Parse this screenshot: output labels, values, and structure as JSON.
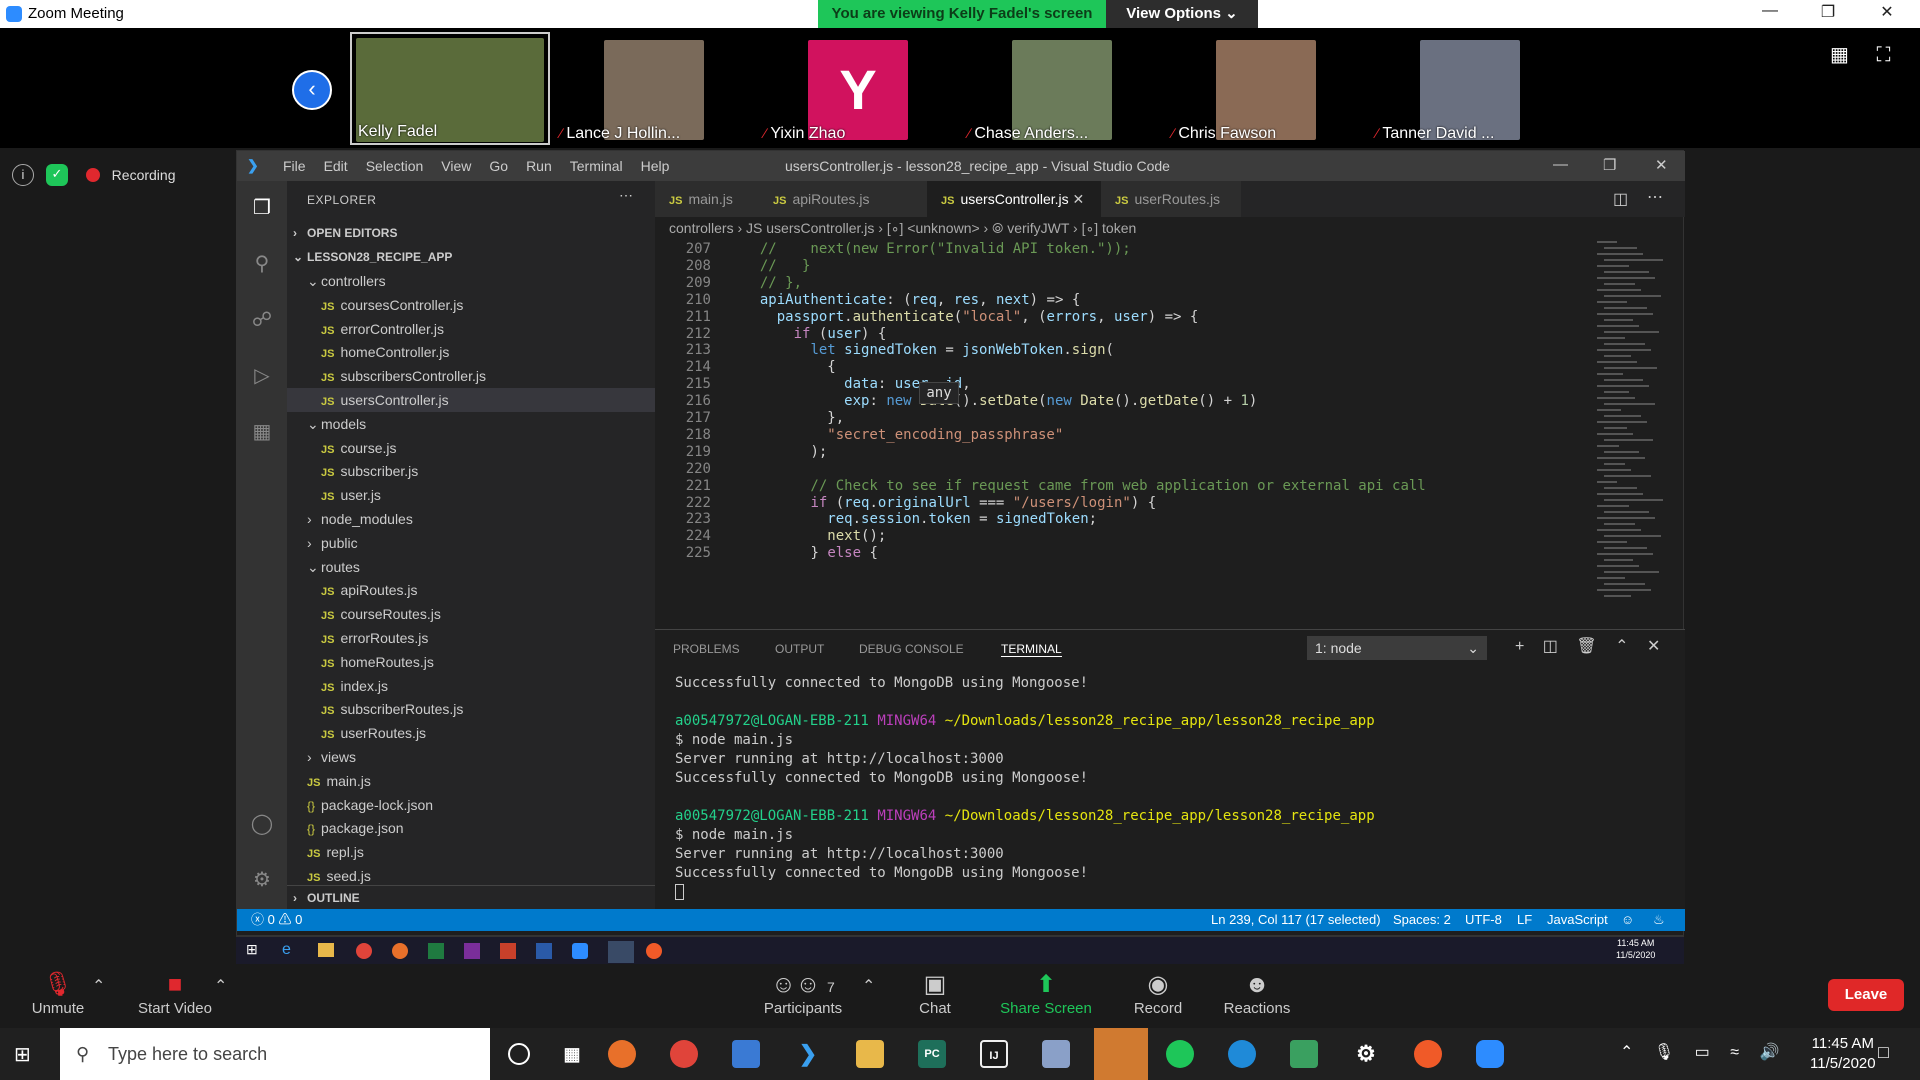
{
  "window": {
    "title": "Zoom Meeting"
  },
  "banner": {
    "viewing": "You are viewing Kelly Fadel's screen",
    "view_options": "View Options ⌄"
  },
  "participants": [
    {
      "name": "Kelly Fadel",
      "muted": false,
      "color": "#5a6b3a"
    },
    {
      "name": "Lance J Hollin...",
      "muted": true,
      "color": "#7a6a5a"
    },
    {
      "name": "Yixin Zhao",
      "muted": true,
      "color": "#d1125e",
      "initial": "Y"
    },
    {
      "name": "Chase Anders...",
      "muted": true,
      "color": "#6b7b5a"
    },
    {
      "name": "Chris Fawson",
      "muted": true,
      "color": "#8a6a55"
    },
    {
      "name": "Tanner David ...",
      "muted": true,
      "color": "#6a7080"
    }
  ],
  "recording": {
    "label": "Recording"
  },
  "vscode": {
    "menu": [
      "File",
      "Edit",
      "Selection",
      "View",
      "Go",
      "Run",
      "Terminal",
      "Help"
    ],
    "title": "usersController.js - lesson28_recipe_app - Visual Studio Code",
    "explorer": {
      "header": "EXPLORER",
      "open_editors": "OPEN EDITORS",
      "project": "LESSON28_RECIPE_APP",
      "outline": "OUTLINE",
      "items": [
        {
          "label": "controllers",
          "type": "folder",
          "open": true,
          "depth": 1
        },
        {
          "label": "coursesController.js",
          "type": "js",
          "depth": 2
        },
        {
          "label": "errorController.js",
          "type": "js",
          "depth": 2
        },
        {
          "label": "homeController.js",
          "type": "js",
          "depth": 2
        },
        {
          "label": "subscribersController.js",
          "type": "js",
          "depth": 2
        },
        {
          "label": "usersController.js",
          "type": "js",
          "depth": 2,
          "selected": true
        },
        {
          "label": "models",
          "type": "folder",
          "open": true,
          "depth": 1
        },
        {
          "label": "course.js",
          "type": "js",
          "depth": 2
        },
        {
          "label": "subscriber.js",
          "type": "js",
          "depth": 2
        },
        {
          "label": "user.js",
          "type": "js",
          "depth": 2
        },
        {
          "label": "node_modules",
          "type": "folder",
          "open": false,
          "depth": 1
        },
        {
          "label": "public",
          "type": "folder",
          "open": false,
          "depth": 1
        },
        {
          "label": "routes",
          "type": "folder",
          "open": true,
          "depth": 1
        },
        {
          "label": "apiRoutes.js",
          "type": "js",
          "depth": 2
        },
        {
          "label": "courseRoutes.js",
          "type": "js",
          "depth": 2
        },
        {
          "label": "errorRoutes.js",
          "type": "js",
          "depth": 2
        },
        {
          "label": "homeRoutes.js",
          "type": "js",
          "depth": 2
        },
        {
          "label": "index.js",
          "type": "js",
          "depth": 2
        },
        {
          "label": "subscriberRoutes.js",
          "type": "js",
          "depth": 2
        },
        {
          "label": "userRoutes.js",
          "type": "js",
          "depth": 2
        },
        {
          "label": "views",
          "type": "folder",
          "open": false,
          "depth": 1
        },
        {
          "label": "main.js",
          "type": "js",
          "depth": 1
        },
        {
          "label": "package-lock.json",
          "type": "json",
          "depth": 1
        },
        {
          "label": "package.json",
          "type": "json",
          "depth": 1
        },
        {
          "label": "repl.js",
          "type": "js",
          "depth": 1
        },
        {
          "label": "seed.js",
          "type": "js",
          "depth": 1
        }
      ]
    },
    "tabs": [
      {
        "label": "main.js",
        "active": false
      },
      {
        "label": "apiRoutes.js",
        "active": false
      },
      {
        "label": "usersController.js",
        "active": true
      },
      {
        "label": "userRoutes.js",
        "active": false
      }
    ],
    "breadcrumb": "controllers › JS usersController.js › [∘] <unknown> › ⦾ verifyJWT › [∘] token",
    "code": [
      {
        "n": "207",
        "t": "  //    next(new Error(\"Invalid API token.\"));",
        "c": "cm"
      },
      {
        "n": "208",
        "t": "  //   }",
        "c": "cm"
      },
      {
        "n": "209",
        "t": "  // },",
        "c": "cm"
      },
      {
        "n": "210",
        "t": "  apiAuthenticate: (req, res, next) => {",
        "c": "mix"
      },
      {
        "n": "211",
        "t": "    passport.authenticate(\"local\", (errors, user) => {",
        "c": "mix"
      },
      {
        "n": "212",
        "t": "      if (user) {",
        "c": "mix"
      },
      {
        "n": "213",
        "t": "        let signedToken = jsonWebToken.sign(",
        "c": "mix"
      },
      {
        "n": "214",
        "t": "          {",
        "c": "pl"
      },
      {
        "n": "215",
        "t": "            data: user._id,",
        "c": "mix"
      },
      {
        "n": "216",
        "t": "            exp: new Date().setDate(new Date().getDate() + 1)",
        "c": "mix"
      },
      {
        "n": "217",
        "t": "          },",
        "c": "pl"
      },
      {
        "n": "218",
        "t": "          \"secret_encoding_passphrase\"",
        "c": "str"
      },
      {
        "n": "219",
        "t": "        );",
        "c": "pl"
      },
      {
        "n": "220",
        "t": "",
        "c": "pl"
      },
      {
        "n": "221",
        "t": "        // Check to see if request came from web application or external api call",
        "c": "cm"
      },
      {
        "n": "222",
        "t": "        if (req.originalUrl === \"/users/login\") {",
        "c": "mix"
      },
      {
        "n": "223",
        "t": "          req.session.token = signedToken;",
        "c": "mix"
      },
      {
        "n": "224",
        "t": "          next();",
        "c": "mix"
      },
      {
        "n": "225",
        "t": "        } else {",
        "c": "mix"
      }
    ],
    "hover": "any",
    "panel": {
      "tabs": [
        "PROBLEMS",
        "OUTPUT",
        "DEBUG CONSOLE",
        "TERMINAL"
      ],
      "terminal_select": "1: node",
      "lines": [
        {
          "t": "Successfully connected to MongoDB using Mongoose!",
          "k": "plain"
        },
        {
          "t": "",
          "k": "plain"
        },
        {
          "user": "a00547972@LOGAN-EBB-211",
          "sys": "MINGW64",
          "path": "~/Downloads/lesson28_recipe_app/lesson28_recipe_app",
          "k": "prompt"
        },
        {
          "t": "$ node main.js",
          "k": "plain"
        },
        {
          "t": "Server running at http://localhost:3000",
          "k": "plain"
        },
        {
          "t": "Successfully connected to MongoDB using Mongoose!",
          "k": "plain"
        },
        {
          "t": "",
          "k": "plain"
        },
        {
          "user": "a00547972@LOGAN-EBB-211",
          "sys": "MINGW64",
          "path": "~/Downloads/lesson28_recipe_app/lesson28_recipe_app",
          "k": "prompt"
        },
        {
          "t": "$ node main.js",
          "k": "plain"
        },
        {
          "t": "Server running at http://localhost:3000",
          "k": "plain"
        },
        {
          "t": "Successfully connected to MongoDB using Mongoose!",
          "k": "plain"
        }
      ]
    },
    "status": {
      "problems": "ⓧ 0 ⚠ 0",
      "position": "Ln 239, Col 117 (17 selected)",
      "spaces": "Spaces: 2",
      "encoding": "UTF-8",
      "eol": "LF",
      "language": "JavaScript"
    },
    "inner_clock": {
      "time": "11:45 AM",
      "date": "11/5/2020"
    }
  },
  "controls": {
    "unmute": "Unmute",
    "start_video": "Start Video",
    "participants": "Participants",
    "participants_count": "7",
    "chat": "Chat",
    "share_screen": "Share Screen",
    "record": "Record",
    "reactions": "Reactions",
    "leave": "Leave"
  },
  "taskbar": {
    "search_placeholder": "Type here to search",
    "time": "11:45 AM",
    "date": "11/5/2020"
  }
}
